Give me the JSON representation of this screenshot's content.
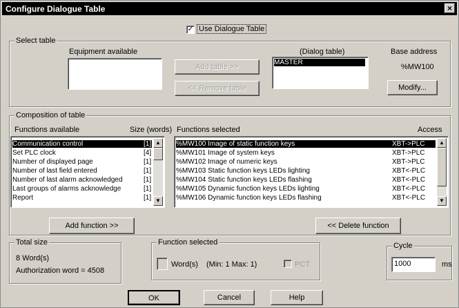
{
  "window": {
    "title": "Configure Dialogue Table",
    "close": "×"
  },
  "use_dialogue_table": {
    "label": "Use Dialogue Table",
    "checked": "✓"
  },
  "select_table": {
    "group_label": "Select table",
    "equipment_label": "Equipment available",
    "add_button": "Add table >>",
    "remove_button": "<< Remove table",
    "dialog_label": "(Dialog table)",
    "dialog_items": [
      "MASTER"
    ],
    "base_address_label": "Base address",
    "base_address_value": "%MW100",
    "modify_button": "Modify..."
  },
  "composition": {
    "group_label": "Composition of table",
    "functions_available_label": "Functions available",
    "size_label": "Size (words)",
    "functions_available": [
      {
        "name": "Communication control",
        "size": "[1]"
      },
      {
        "name": "Set PLC clock",
        "size": "[4]"
      },
      {
        "name": "Number of displayed page",
        "size": "[1]"
      },
      {
        "name": "Number of last field entered",
        "size": "[1]"
      },
      {
        "name": "Number of last alarm acknowledged",
        "size": "[1]"
      },
      {
        "name": "Last groups of alarms acknowledge",
        "size": "[1]"
      },
      {
        "name": "Report",
        "size": "[1]"
      }
    ],
    "functions_selected_label": "Functions selected",
    "access_label": "Access",
    "functions_selected": [
      {
        "name": "%MW100 Image of static function keys",
        "access": "XBT->PLC"
      },
      {
        "name": "%MW101 Image of system keys",
        "access": "XBT->PLC"
      },
      {
        "name": "%MW102 Image of numeric keys",
        "access": "XBT->PLC"
      },
      {
        "name": "%MW103 Static function keys LEDs lighting",
        "access": "XBT<-PLC"
      },
      {
        "name": "%MW104 Static function keys LEDs flashing",
        "access": "XBT<-PLC"
      },
      {
        "name": "%MW105 Dynamic function keys LEDs lighting",
        "access": "XBT<-PLC"
      },
      {
        "name": "%MW106 Dynamic function keys LEDs flashing",
        "access": "XBT<-PLC"
      }
    ],
    "add_function_button": "Add function >>",
    "delete_function_button": "<< Delete function"
  },
  "total_size": {
    "group_label": "Total size",
    "words": "8 Word(s)",
    "authorization": "Authorization word = 4508"
  },
  "function_selected": {
    "group_label": "Function selected",
    "words_label": "Word(s)",
    "range": "(Min: 1 Max: 1)",
    "pct_label": "PCT"
  },
  "cycle": {
    "group_label": "Cycle",
    "value": "1000",
    "unit": "ms"
  },
  "footer": {
    "ok": "OK",
    "cancel": "Cancel",
    "help": "Help"
  }
}
